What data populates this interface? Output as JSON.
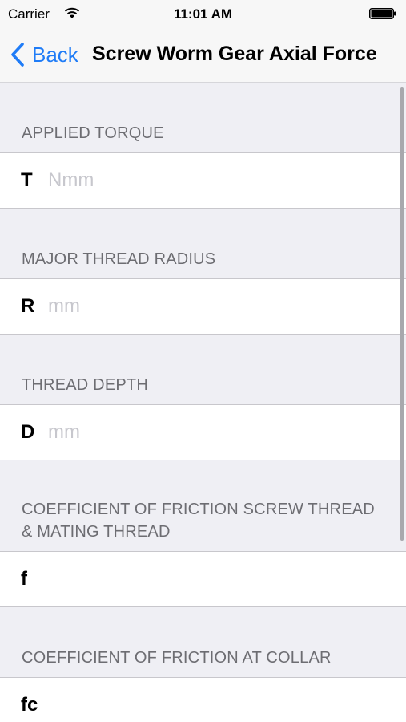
{
  "status_bar": {
    "carrier": "Carrier",
    "time": "11:01 AM"
  },
  "nav": {
    "back_label": "Back",
    "title": "Screw Worm Gear Axial Force"
  },
  "sections": [
    {
      "header": "APPLIED TORQUE",
      "symbol": "T",
      "placeholder": "Nmm"
    },
    {
      "header": "MAJOR THREAD RADIUS",
      "symbol": "R",
      "placeholder": "mm"
    },
    {
      "header": "THREAD DEPTH",
      "symbol": "D",
      "placeholder": "mm"
    },
    {
      "header": "COEFFICIENT OF FRICTION SCREW THREAD & MATING THREAD",
      "symbol": "f",
      "placeholder": ""
    },
    {
      "header": "COEFFICIENT OF FRICTION AT COLLAR",
      "symbol": "fc",
      "placeholder": ""
    }
  ],
  "colors": {
    "accent": "#1f7cf7",
    "background": "#efeff4",
    "section_header_text": "#6d6d72",
    "placeholder_text": "#c7c7cd"
  }
}
